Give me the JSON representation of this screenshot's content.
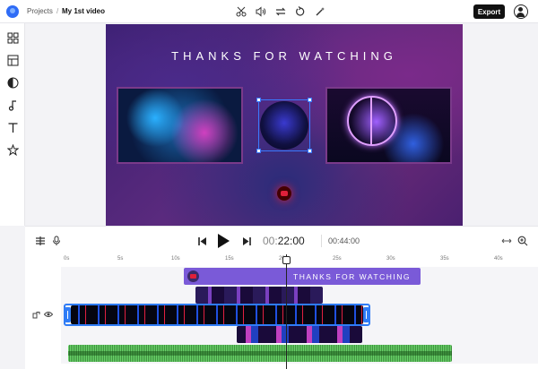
{
  "topbar": {
    "breadcrumb_root": "Projects",
    "breadcrumb_sep": "/",
    "project_name": "My 1st video",
    "tools": [
      "scissors-icon",
      "volume-icon",
      "swap-icon",
      "rotate-icon",
      "magic-wand-icon"
    ],
    "export_label": "Export"
  },
  "rail": {
    "items": [
      "media-icon",
      "templates-icon",
      "transitions-icon",
      "music-icon",
      "text-icon",
      "elements-icon"
    ]
  },
  "stage": {
    "title": "THANKS FOR WATCHING"
  },
  "controls": {
    "current_time_prefix": "00:",
    "current_time_main": "22:00",
    "total_time": "00:44:00"
  },
  "timeline": {
    "ruler_labels": [
      "0s",
      "5s",
      "10s",
      "15s",
      "20s",
      "25s",
      "30s",
      "35s",
      "40s"
    ],
    "text_clip_label": "THANKS FOR WATCHING"
  },
  "colors": {
    "accent": "#2f7cf6",
    "text_clip": "#7a5ad8",
    "audio_clip": "#6ad46a"
  }
}
